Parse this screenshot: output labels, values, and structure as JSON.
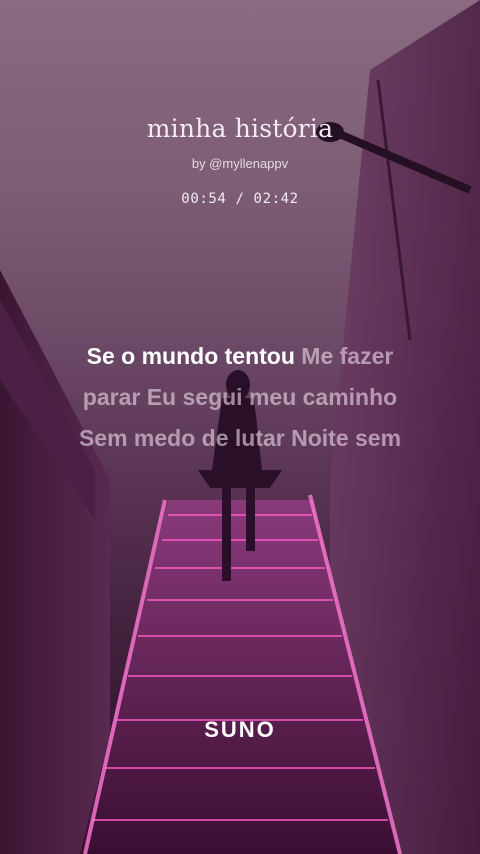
{
  "song": {
    "title": "minha história",
    "byline": "by @myllenappv",
    "elapsed": "00:54",
    "separator": " / ",
    "duration": "02:42"
  },
  "lyrics": {
    "line1_sung": "Se o mundo tentou",
    "line1_rest": "Me fazer",
    "line2": "parar Eu segui meu caminho",
    "line3": "Sem medo de lutar Noite sem"
  },
  "brand": {
    "logo_text": "SUNO"
  },
  "colors": {
    "lyric_active": "#ffffff",
    "lyric_inactive": "#e8d6e6",
    "neon": "#ff4fc0"
  }
}
